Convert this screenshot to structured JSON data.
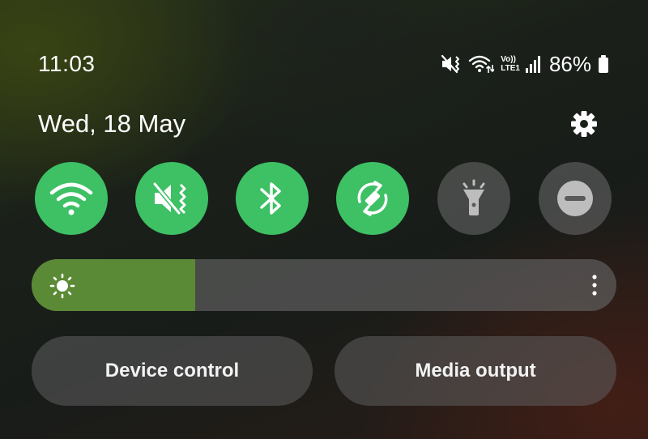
{
  "status_bar": {
    "time": "11:03",
    "volte_top": "Vo))",
    "volte_bottom": "LTE1",
    "battery_percent": "86%",
    "icons": [
      "mute-vibrate-icon",
      "wifi-data-icon",
      "volte-lte-icon",
      "signal-icon",
      "battery-icon"
    ]
  },
  "header": {
    "date": "Wed, 18 May",
    "settings_icon": "gear-icon"
  },
  "quick_tiles": [
    {
      "icon": "wifi-icon",
      "state": "on"
    },
    {
      "icon": "mute-vibrate-icon",
      "state": "on"
    },
    {
      "icon": "bluetooth-icon",
      "state": "on"
    },
    {
      "icon": "auto-rotate-icon",
      "state": "on"
    },
    {
      "icon": "flashlight-icon",
      "state": "off"
    },
    {
      "icon": "do-not-disturb-icon",
      "state": "off"
    }
  ],
  "brightness": {
    "level": 0.28,
    "icon": "sun-icon",
    "menu_icon": "more-vertical-icon"
  },
  "buttons": {
    "device_control": "Device control",
    "media_output": "Media output"
  },
  "colors": {
    "tile_on": "#3ec064",
    "tile_off": "#6e6e6e",
    "brightness_fill": "#5b8a36"
  }
}
